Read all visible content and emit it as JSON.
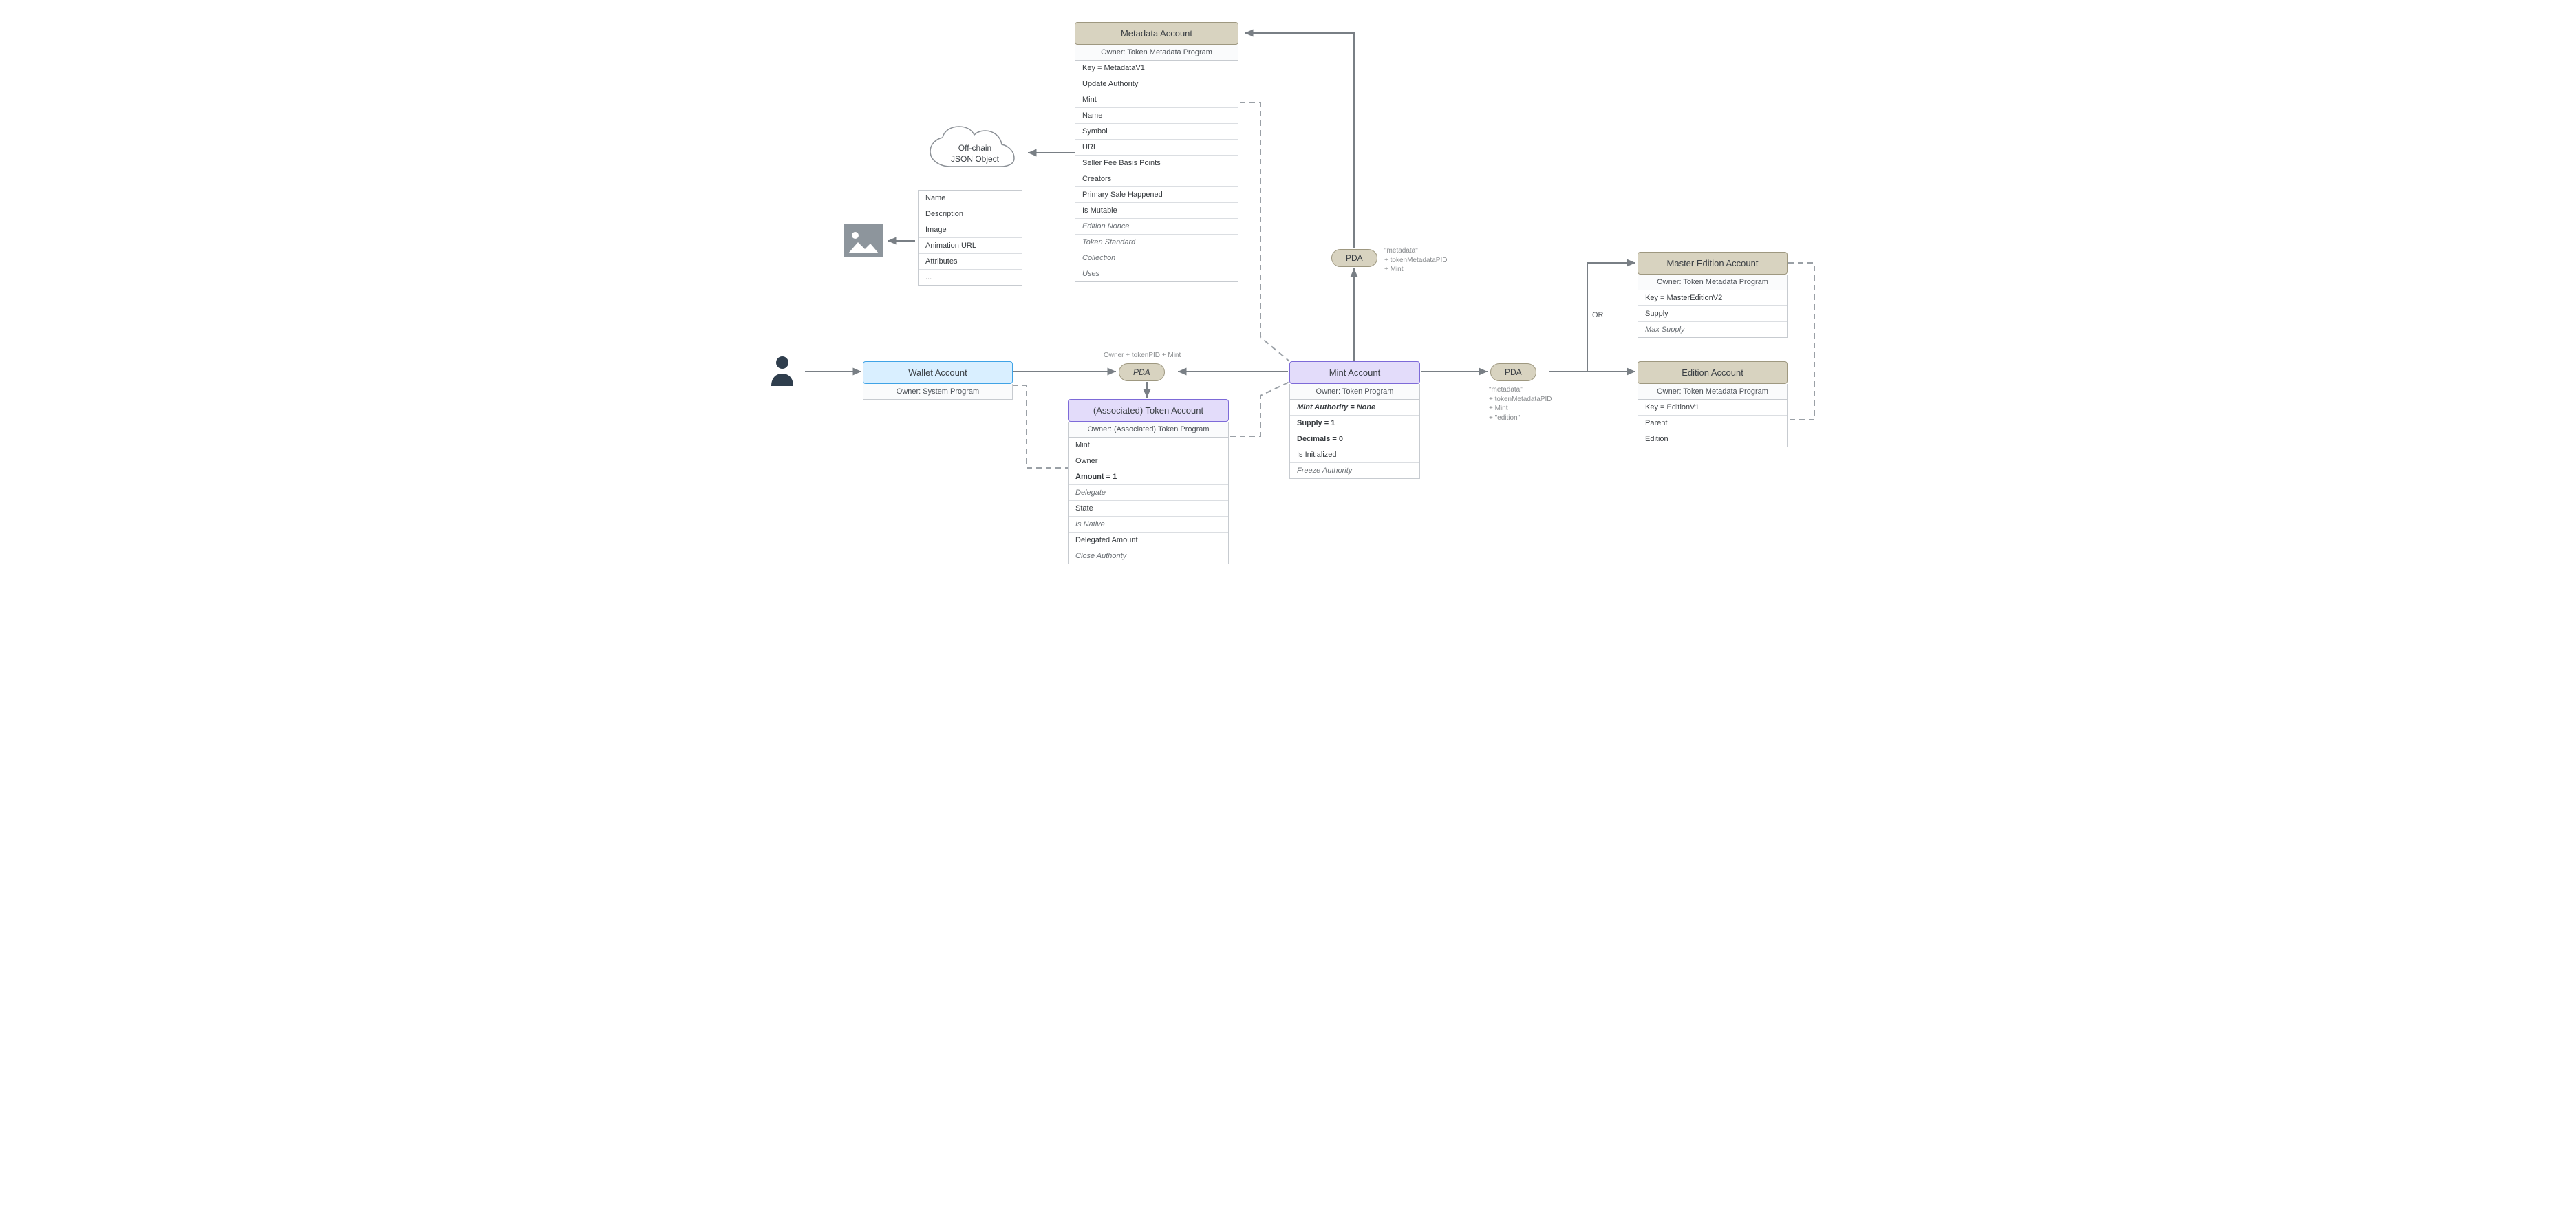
{
  "wallet": {
    "title": "Wallet Account",
    "owner": "Owner: System Program"
  },
  "pda_assoc": {
    "label": "PDA",
    "seeds": "Owner + tokenPID + Mint"
  },
  "token_account": {
    "title": "(Associated) Token Account",
    "owner": "Owner: (Associated) Token Program",
    "fields": [
      {
        "t": "Mint"
      },
      {
        "t": "Owner"
      },
      {
        "t": "Amount = 1",
        "s": "bold"
      },
      {
        "t": "Delegate",
        "s": "italic"
      },
      {
        "t": "State"
      },
      {
        "t": "Is Native",
        "s": "italic"
      },
      {
        "t": "Delegated Amount"
      },
      {
        "t": "Close Authority",
        "s": "italic"
      }
    ]
  },
  "mint": {
    "title": "Mint Account",
    "owner": "Owner: Token Program",
    "fields": [
      {
        "t": "Mint Authority = None",
        "s": "bolditalic"
      },
      {
        "t": "Supply = 1",
        "s": "bold"
      },
      {
        "t": "Decimals = 0",
        "s": "bold"
      },
      {
        "t": "Is Initialized"
      },
      {
        "t": "Freeze Authority",
        "s": "italic"
      }
    ]
  },
  "pda_meta": {
    "label": "PDA",
    "seeds": "\"metadata\"\n+ tokenMetadataPID\n+ Mint"
  },
  "pda_ed": {
    "label": "PDA",
    "seeds": "\"metadata\"\n+ tokenMetadataPID\n+ Mint\n+ \"edition\""
  },
  "or": "OR",
  "metadata": {
    "title": "Metadata Account",
    "owner": "Owner: Token Metadata Program",
    "fields": [
      {
        "t": "Key = MetadataV1"
      },
      {
        "t": "Update Authority"
      },
      {
        "t": "Mint"
      },
      {
        "t": "Name"
      },
      {
        "t": "Symbol"
      },
      {
        "t": "URI"
      },
      {
        "t": "Seller Fee Basis Points"
      },
      {
        "t": "Creators"
      },
      {
        "t": "Primary Sale Happened"
      },
      {
        "t": "Is Mutable"
      },
      {
        "t": "Edition Nonce",
        "s": "italic"
      },
      {
        "t": "Token Standard",
        "s": "italic"
      },
      {
        "t": "Collection",
        "s": "italic"
      },
      {
        "t": "Uses",
        "s": "italic"
      }
    ]
  },
  "offchain": {
    "title": "Off-chain\nJSON Object",
    "fields": [
      {
        "t": "Name"
      },
      {
        "t": "Description"
      },
      {
        "t": "Image"
      },
      {
        "t": "Animation URL"
      },
      {
        "t": "Attributes"
      },
      {
        "t": "..."
      }
    ]
  },
  "master": {
    "title": "Master Edition Account",
    "owner": "Owner: Token Metadata Program",
    "fields": [
      {
        "t": "Key = MasterEditionV2"
      },
      {
        "t": "Supply"
      },
      {
        "t": "Max Supply",
        "s": "italic"
      }
    ]
  },
  "edition": {
    "title": "Edition Account",
    "owner": "Owner: Token Metadata Program",
    "fields": [
      {
        "t": "Key = EditionV1"
      },
      {
        "t": "Parent"
      },
      {
        "t": "Edition"
      }
    ]
  }
}
